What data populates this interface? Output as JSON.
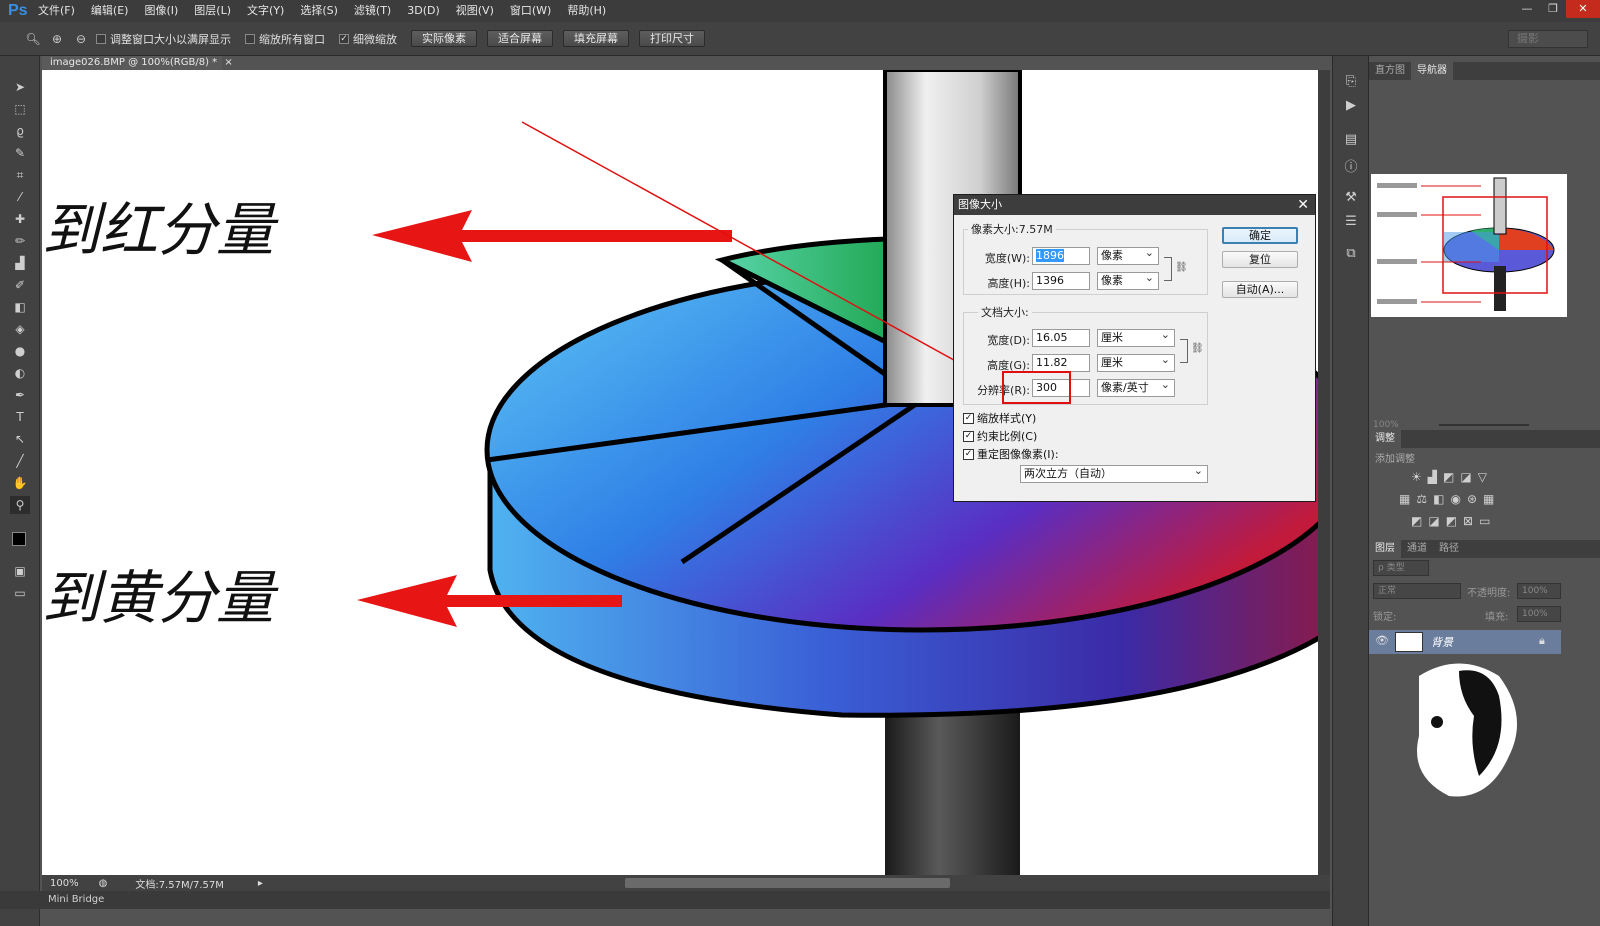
{
  "app": {
    "logo": "Ps",
    "menus": [
      "文件(F)",
      "编辑(E)",
      "图像(I)",
      "图层(L)",
      "文字(Y)",
      "选择(S)",
      "滤镜(T)",
      "3D(D)",
      "视图(V)",
      "窗口(W)",
      "帮助(H)"
    ],
    "window_controls": [
      "—",
      "❐",
      "✕"
    ]
  },
  "options": {
    "resize_windows": "调整窗口大小以满屏显示",
    "zoom_all": "缩放所有窗口",
    "scrubby_zoom": "细微缩放",
    "actual_pixels": "实际像素",
    "fit_screen": "适合屏幕",
    "fill_screen": "填充屏幕",
    "print_size": "打印尺寸",
    "workspace": "摄影"
  },
  "document": {
    "tab_title": "image026.BMP @ 100%(RGB/8) *",
    "tab_close": "×",
    "zoom": "100%",
    "doc_size": "文档:7.57M/7.57M",
    "mini_bridge": "Mini Bridge"
  },
  "canvas_text": {
    "top_label": "到红分量",
    "bottom_label": "到黄分量",
    "top_partial": "》"
  },
  "panels": {
    "top_tabs": [
      "直方图",
      "导航器"
    ],
    "nav_zoom": "100%",
    "adjust_tab": "调整",
    "adjust_hint": "添加调整",
    "layer_tabs": [
      "图层",
      "通道",
      "路径"
    ],
    "kind_filter": "ρ 类型",
    "blend_mode": "正常",
    "opacity_label": "不透明度:",
    "opacity_value": "100%",
    "lock_label": "锁定:",
    "fill_label": "填充:",
    "fill_value": "100%",
    "layer_name": "背景"
  },
  "dialog": {
    "title": "图像大小",
    "close": "✕",
    "pixel_dimensions": "像素大小:7.57M",
    "width_label": "宽度(W):",
    "width_value": "1896",
    "width_unit": "像素",
    "height_label": "高度(H):",
    "height_value": "1396",
    "height_unit": "像素",
    "doc_size_title": "文档大小:",
    "doc_width_label": "宽度(D):",
    "doc_width_value": "16.05",
    "doc_width_unit": "厘米",
    "doc_height_label": "高度(G):",
    "doc_height_value": "11.82",
    "doc_height_unit": "厘米",
    "resolution_label": "分辨率(R):",
    "resolution_value": "300",
    "resolution_unit": "像素/英寸",
    "scale_styles": "缩放样式(Y)",
    "constrain": "约束比例(C)",
    "resample": "重定图像像素(I):",
    "resample_method": "两次立方（自动）",
    "ok": "确定",
    "reset": "复位",
    "auto": "自动(A)..."
  },
  "colors": {
    "accent_red": "#e01010",
    "ps_blue": "#3a8ee6"
  }
}
